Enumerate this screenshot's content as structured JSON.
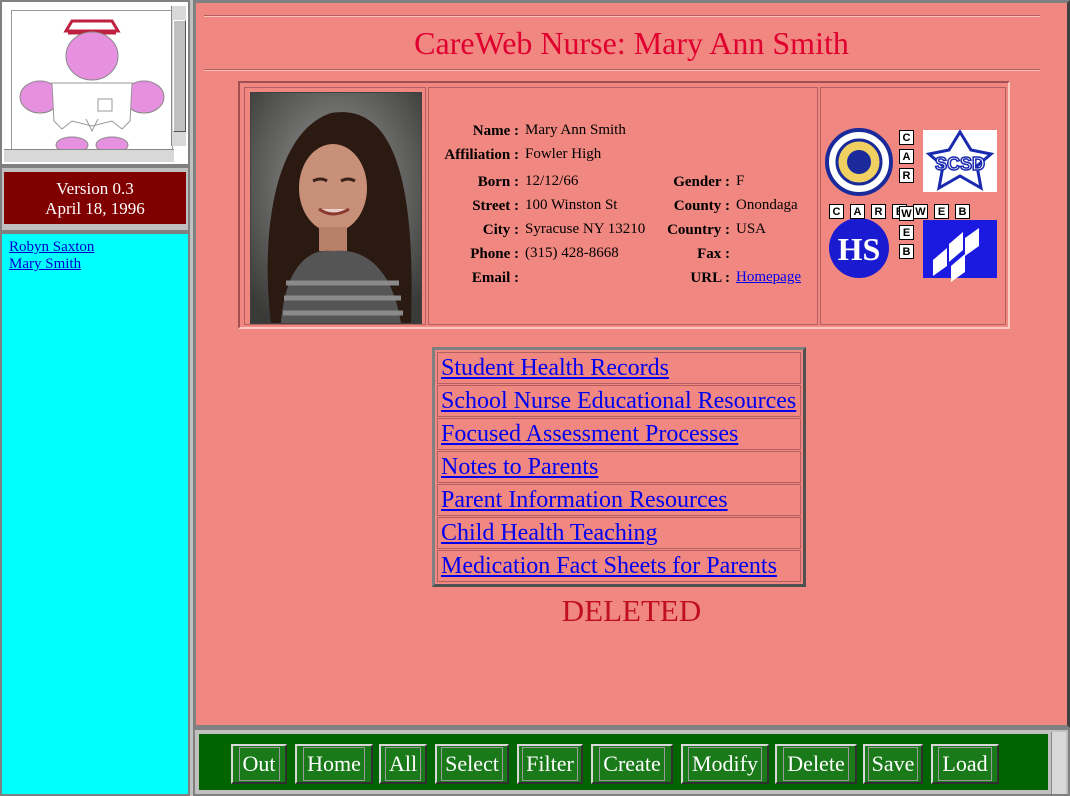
{
  "sidebar": {
    "version": "Version 0.3",
    "date": "April 18, 1996",
    "people": [
      "Robyn Saxton",
      "Mary Smith"
    ]
  },
  "main": {
    "title": "CareWeb Nurse: Mary Ann Smith",
    "profile": {
      "name_label": "Name :",
      "name": "Mary Ann Smith",
      "affiliation_label": "Affiliation :",
      "affiliation": "Fowler High",
      "born_label": "Born :",
      "born": "12/12/66",
      "gender_label": "Gender :",
      "gender": "F",
      "street_label": "Street :",
      "street": "100 Winston St",
      "county_label": "County :",
      "county": "Onondaga",
      "city_label": "City :",
      "city": "Syracuse NY 13210",
      "country_label": "Country :",
      "country": "USA",
      "phone_label": "Phone :",
      "phone": "(315) 428-8668",
      "fax_label": "Fax :",
      "fax": "",
      "email_label": "Email :",
      "email": "",
      "url_label": "URL :",
      "url_link": "Homepage"
    },
    "logos": {
      "careweb_letters_horizontal": [
        "C",
        "A",
        "R",
        "E",
        "W",
        "E",
        "B"
      ],
      "careweb_letters_vertical": [
        "C",
        "A",
        "R",
        "E",
        "W",
        "E",
        "B"
      ],
      "scsd": "SCSD",
      "hs": "HS"
    },
    "links": [
      "Student Health Records",
      "School Nurse Educational Resources",
      "Focused Assessment Processes",
      "Notes to Parents",
      "Parent Information Resources",
      "Child Health Teaching",
      "Medication Fact Sheets for Parents"
    ],
    "status": "DELETED"
  },
  "toolbar": {
    "buttons": [
      "Out",
      "Home",
      "All",
      "Select",
      "Filter",
      "Create",
      "Modify",
      "Delete",
      "Save",
      "Load"
    ]
  },
  "colors": {
    "main_bg": "#f08780",
    "title": "#e00030",
    "nav_bg": "#00ffff",
    "version_bg": "#800000",
    "toolbar_bg": "#006400"
  }
}
